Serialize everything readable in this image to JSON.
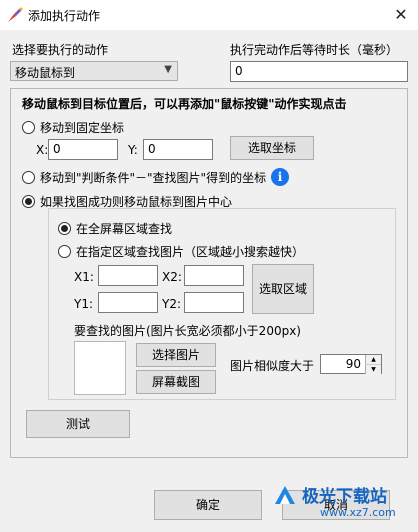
{
  "window": {
    "title": "添加执行动作",
    "close_glyph": "✕"
  },
  "action": {
    "label": "选择要执行的动作",
    "selected": "移动鼠标到"
  },
  "wait": {
    "label": "执行完动作后等待时长（毫秒）",
    "value": "0"
  },
  "panel": {
    "heading": "移动鼠标到目标位置后，可以再添加\"鼠标按键\"动作实现点击",
    "opt_fixed": "移动到固定坐标",
    "x_label": "X:",
    "x_value": "0",
    "y_label": "Y:",
    "y_value": "0",
    "pick_coord": "选取坐标",
    "opt_condition": "移动到\"判断条件\"－\"查找图片\"得到的坐标",
    "opt_image_center": "如果找图成功则移动鼠标到图片中心",
    "sub": {
      "opt_full_screen": "在全屏幕区域查找",
      "opt_region": "在指定区域查找图片（区域越小搜索越快）",
      "x1_label": "X1:",
      "x1_value": "",
      "x2_label": "X2:",
      "x2_value": "",
      "y1_label": "Y1:",
      "y1_value": "",
      "y2_label": "Y2:",
      "y2_value": "",
      "pick_region": "选取区域",
      "image_note": "要查找的图片(图片长宽必须都小于200px)",
      "choose_image": "选择图片",
      "screenshot": "屏幕截图",
      "similarity_label": "图片相似度大于",
      "similarity_value": "90"
    },
    "test": "测试"
  },
  "footer": {
    "ok": "确定",
    "cancel": "取消"
  },
  "watermark": {
    "text": "极光下载站",
    "url": "www.xz7.com"
  },
  "colors": {
    "info": "#1a73e8",
    "watermark": "#1565c0"
  }
}
